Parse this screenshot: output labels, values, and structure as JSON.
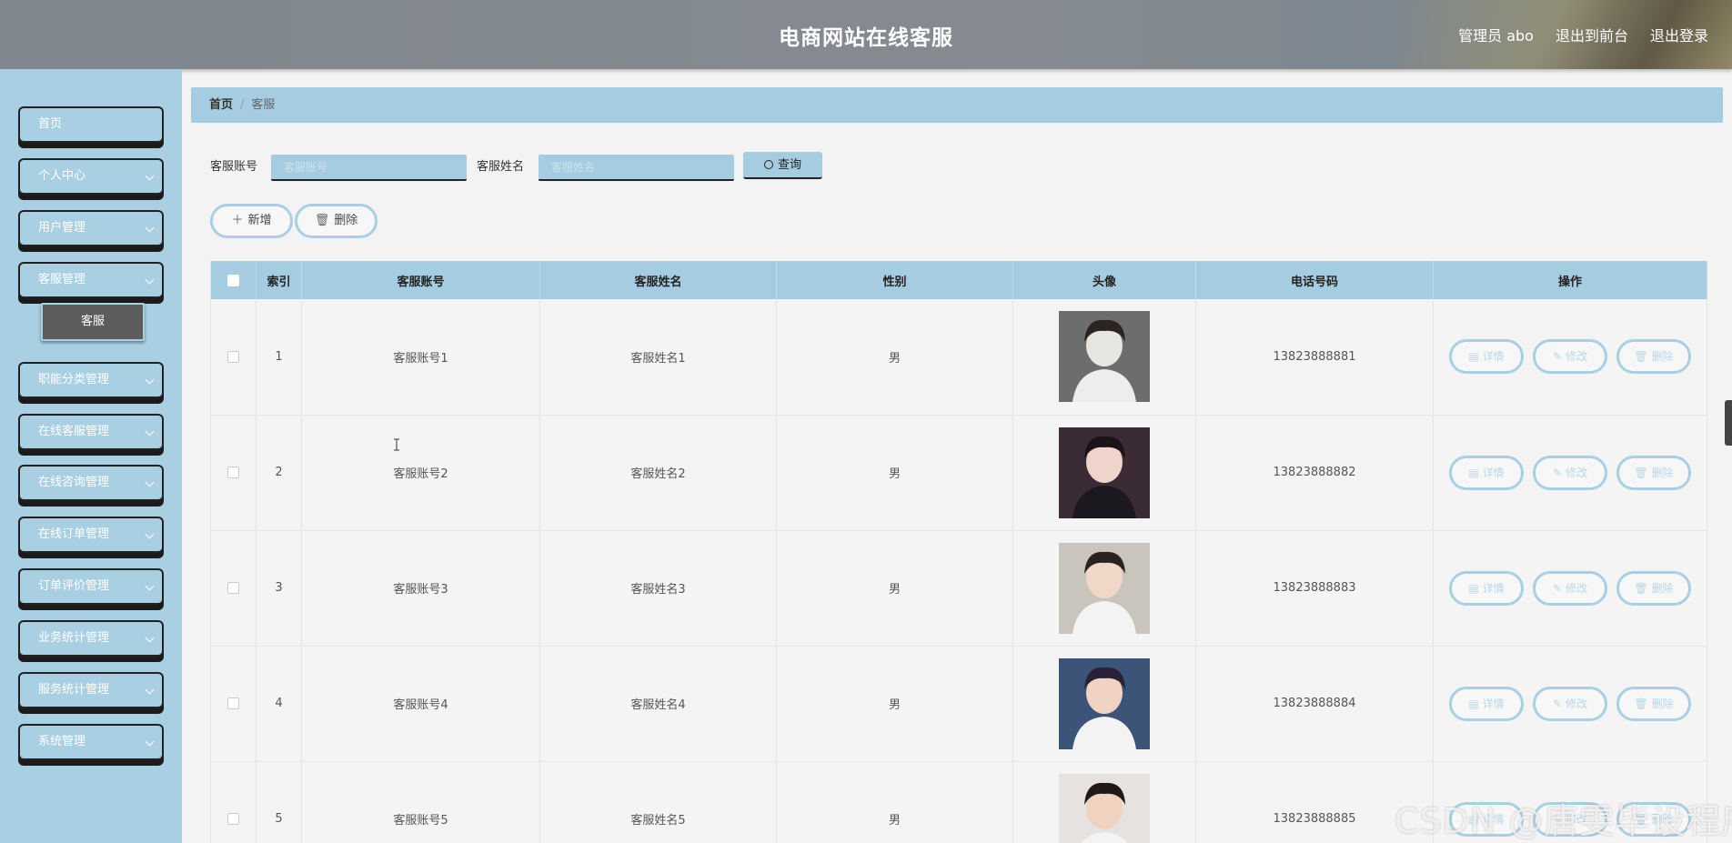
{
  "header": {
    "title": "电商网站在线客服",
    "nav": [
      "管理员 abo",
      "退出到前台",
      "退出登录"
    ]
  },
  "sidebar": {
    "items": [
      {
        "label": "首页",
        "expandable": false
      },
      {
        "label": "个人中心",
        "expandable": true
      },
      {
        "label": "用户管理",
        "expandable": true
      },
      {
        "label": "客服管理",
        "expandable": true
      },
      {
        "label": "职能分类管理",
        "expandable": true
      },
      {
        "label": "在线客服管理",
        "expandable": true
      },
      {
        "label": "在线咨询管理",
        "expandable": true
      },
      {
        "label": "在线订单管理",
        "expandable": true
      },
      {
        "label": "订单评价管理",
        "expandable": true
      },
      {
        "label": "业务统计管理",
        "expandable": true
      },
      {
        "label": "服务统计管理",
        "expandable": true
      },
      {
        "label": "系统管理",
        "expandable": true
      }
    ],
    "active_submenu": "客服"
  },
  "breadcrumb": {
    "home": "首页",
    "current": "客服"
  },
  "search": {
    "account_label": "客服账号",
    "account_placeholder": "客服账号",
    "name_label": "客服姓名",
    "name_placeholder": "客服姓名",
    "query_label": "查询"
  },
  "actions": {
    "add_label": "新增",
    "delete_label": "删除"
  },
  "table": {
    "columns": [
      "索引",
      "客服账号",
      "客服姓名",
      "性别",
      "头像",
      "电话号码",
      "操作"
    ],
    "row_buttons": [
      "详情",
      "修改",
      "删除"
    ],
    "rows": [
      {
        "index": "1",
        "account": "客服账号1",
        "name": "客服姓名1",
        "gender": "男",
        "phone": "13823888881"
      },
      {
        "index": "2",
        "account": "客服账号2",
        "name": "客服姓名2",
        "gender": "男",
        "phone": "13823888882"
      },
      {
        "index": "3",
        "account": "客服账号3",
        "name": "客服姓名3",
        "gender": "男",
        "phone": "13823888883"
      },
      {
        "index": "4",
        "account": "客服账号4",
        "name": "客服姓名4",
        "gender": "男",
        "phone": "13823888884"
      },
      {
        "index": "5",
        "account": "客服账号5",
        "name": "客服姓名5",
        "gender": "男",
        "phone": "13823888885"
      }
    ]
  },
  "watermark": "CSDN @唐雯毕设程序",
  "colors": {
    "accent": "#a5cce0",
    "sidebar": "#a9cfe2",
    "header": "#80878d"
  }
}
